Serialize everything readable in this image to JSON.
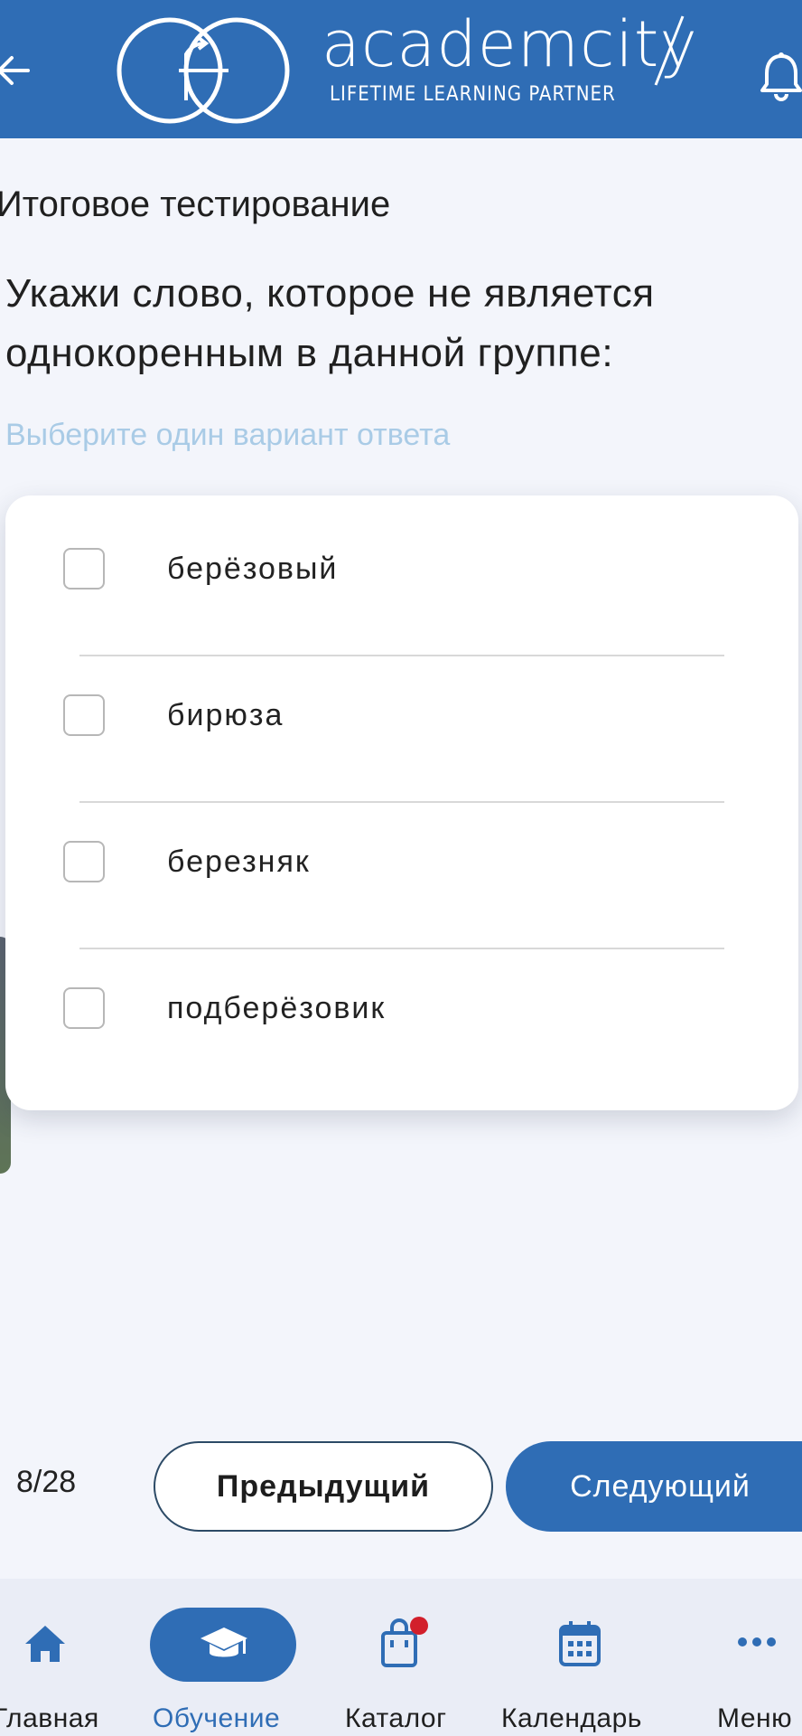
{
  "header": {
    "brand": "academcity",
    "tagline": "LIFETIME LEARNING PARTNER"
  },
  "page_title": "Итоговое тестирование",
  "question": "Укажи слово, которое не является однокоренным в данной группе:",
  "hint": "Выберите один вариант ответа",
  "options": [
    {
      "label": "берёзовый",
      "checked": false
    },
    {
      "label": "бирюза",
      "checked": false
    },
    {
      "label": "березняк",
      "checked": false
    },
    {
      "label": "подберёзовик",
      "checked": false
    }
  ],
  "pagination": {
    "counter": "8/28",
    "prev_label": "Предыдущий",
    "next_label": "Следующий"
  },
  "nav": {
    "items": [
      {
        "label": "Главная",
        "icon": "home-icon"
      },
      {
        "label": "Обучение",
        "icon": "graduation-cap-icon",
        "active": true
      },
      {
        "label": "Каталог",
        "icon": "shopping-bag-icon",
        "badge": true
      },
      {
        "label": "Календарь",
        "icon": "calendar-icon"
      },
      {
        "label": "Меню",
        "icon": "more-icon"
      }
    ]
  },
  "colors": {
    "primary": "#2f6db5",
    "hint": "#a9cbe6",
    "badge": "#d21f2b",
    "nav_bg": "#eaedf6"
  }
}
